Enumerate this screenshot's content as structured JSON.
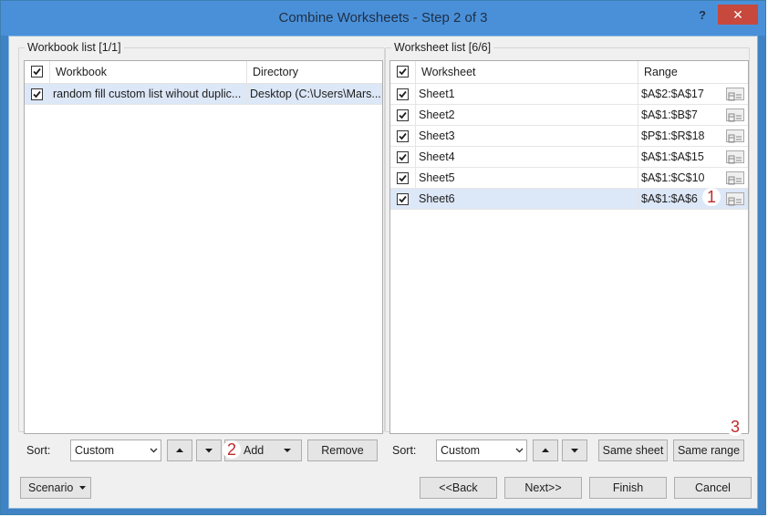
{
  "window": {
    "title": "Combine Worksheets - Step 2 of 3",
    "help": "?",
    "close": "✕"
  },
  "workbook_list": {
    "legend": "Workbook list [1/1]",
    "columns": [
      "Workbook",
      "Directory"
    ],
    "rows": [
      {
        "workbook": "random fill custom list wihout duplic...",
        "directory": "Desktop (C:\\Users\\Mars..."
      }
    ]
  },
  "worksheet_list": {
    "legend": "Worksheet list [6/6]",
    "columns": [
      "Worksheet",
      "Range"
    ],
    "rows": [
      {
        "name": "Sheet1",
        "range": "$A$2:$A$17"
      },
      {
        "name": "Sheet2",
        "range": "$A$1:$B$7"
      },
      {
        "name": "Sheet3",
        "range": "$P$1:$R$18"
      },
      {
        "name": "Sheet4",
        "range": "$A$1:$A$15"
      },
      {
        "name": "Sheet5",
        "range": "$A$1:$C$10"
      },
      {
        "name": "Sheet6",
        "range": "$A$1:$A$6"
      }
    ]
  },
  "left_controls": {
    "sort_label": "Sort:",
    "sort_value": "Custom",
    "add": "Add",
    "remove": "Remove"
  },
  "right_controls": {
    "sort_label": "Sort:",
    "sort_value": "Custom",
    "same_sheet": "Same sheet",
    "same_range": "Same range"
  },
  "footer": {
    "scenario": "Scenario",
    "back": "<<Back",
    "next": "Next>>",
    "finish": "Finish",
    "cancel": "Cancel"
  },
  "annotations": [
    "1",
    "2",
    "3"
  ],
  "colors": {
    "titlebar": "#4a90d9",
    "close": "#c7483c",
    "selected_row": "#dce7f7",
    "annotation": "#c02b2b"
  }
}
